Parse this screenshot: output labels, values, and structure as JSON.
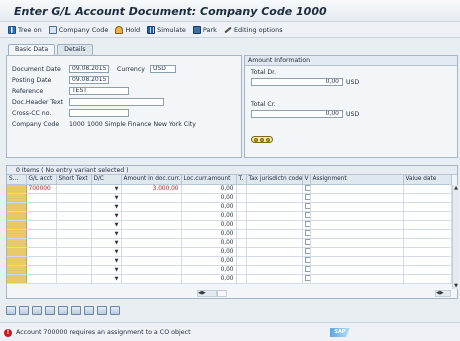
{
  "title": "Enter G/L Account Document: Company Code 1000",
  "toolbar": [
    {
      "label": "Tree on",
      "icon": "tree-icon"
    },
    {
      "label": "Company Code",
      "icon": "company-code-icon"
    },
    {
      "label": "Hold",
      "icon": "hold-icon"
    },
    {
      "label": "Simulate",
      "icon": "simulate-icon"
    },
    {
      "label": "Park",
      "icon": "park-icon"
    },
    {
      "label": "Editing options",
      "icon": "pencil-icon"
    }
  ],
  "tabs": [
    "Basic Data",
    "Details"
  ],
  "header": {
    "document_date_label": "Document Date",
    "document_date": "09.08.2015",
    "currency_label": "Currency",
    "currency": "USD",
    "posting_date_label": "Posting Date",
    "posting_date": "09.08.2015",
    "reference_label": "Reference",
    "reference": "TEST",
    "doc_header_text_label": "Doc.Header Text",
    "doc_header_text": "",
    "cross_cc_label": "Cross-CC no.",
    "cross_cc": "",
    "company_code_label": "Company Code",
    "company_code": "1000",
    "company_name": "1000 Simple Finance New York City"
  },
  "amount_info": {
    "title": "Amount Information",
    "total_dr_label": "Total Dr.",
    "total_dr": "0,00",
    "total_dr_currency": "USD",
    "total_cr_label": "Total Cr.",
    "total_cr": "0,00",
    "total_cr_currency": "USD"
  },
  "grid": {
    "title": "0 Items ( No entry variant selected )",
    "columns": [
      "S...",
      "G/L acct",
      "Short Text",
      "D/C",
      "Amount in doc.curr.",
      "Loc.curr.amount",
      "T.",
      "Tax jurisdictn code",
      "V",
      "Assignment",
      "Value date"
    ],
    "rows": [
      {
        "gl": "700000",
        "short_text": "",
        "amount": "3.000,00",
        "loc": "0,00"
      },
      {
        "gl": "",
        "short_text": "",
        "amount": "",
        "loc": "0,00"
      },
      {
        "gl": "",
        "short_text": "",
        "amount": "",
        "loc": "0,00"
      },
      {
        "gl": "",
        "short_text": "",
        "amount": "",
        "loc": "0,00"
      },
      {
        "gl": "",
        "short_text": "",
        "amount": "",
        "loc": "0,00"
      },
      {
        "gl": "",
        "short_text": "",
        "amount": "",
        "loc": "0,00"
      },
      {
        "gl": "",
        "short_text": "",
        "amount": "",
        "loc": "0,00"
      },
      {
        "gl": "",
        "short_text": "",
        "amount": "",
        "loc": "0,00"
      },
      {
        "gl": "",
        "short_text": "",
        "amount": "",
        "loc": "0,00"
      },
      {
        "gl": "",
        "short_text": "",
        "amount": "",
        "loc": "0,00"
      },
      {
        "gl": "",
        "short_text": "",
        "amount": "",
        "loc": "0,00"
      }
    ]
  },
  "status": {
    "message": "Account 700000 requires an assignment to a CO object"
  }
}
